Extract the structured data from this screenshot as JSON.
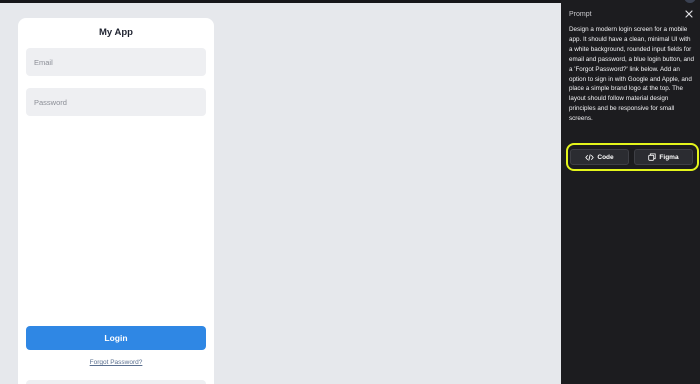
{
  "app": {
    "title": "My App",
    "email_placeholder": "Email",
    "password_placeholder": "Password",
    "login_label": "Login",
    "forgot_label": "Forgot Password?"
  },
  "panel": {
    "title": "Prompt",
    "prompt_text": "Design a modern login screen for a mobile app. It should have a clean, minimal UI with a white background, rounded input fields for email and password, a blue login button, and a 'Forgot Password?' link below. Add an option to sign in with Google and Apple, and place a simple brand logo at the top. The layout should follow material design principles and be responsive for small screens.",
    "code_label": "Code",
    "figma_label": "Figma",
    "close_icon": "close-icon",
    "code_icon": "code-icon",
    "figma_icon": "copy-frame-icon"
  },
  "colors": {
    "canvas_bg": "#e6e8ec",
    "login_button": "#2f87e4",
    "panel_bg": "#1c1c1f",
    "highlight": "#e4f51b"
  }
}
